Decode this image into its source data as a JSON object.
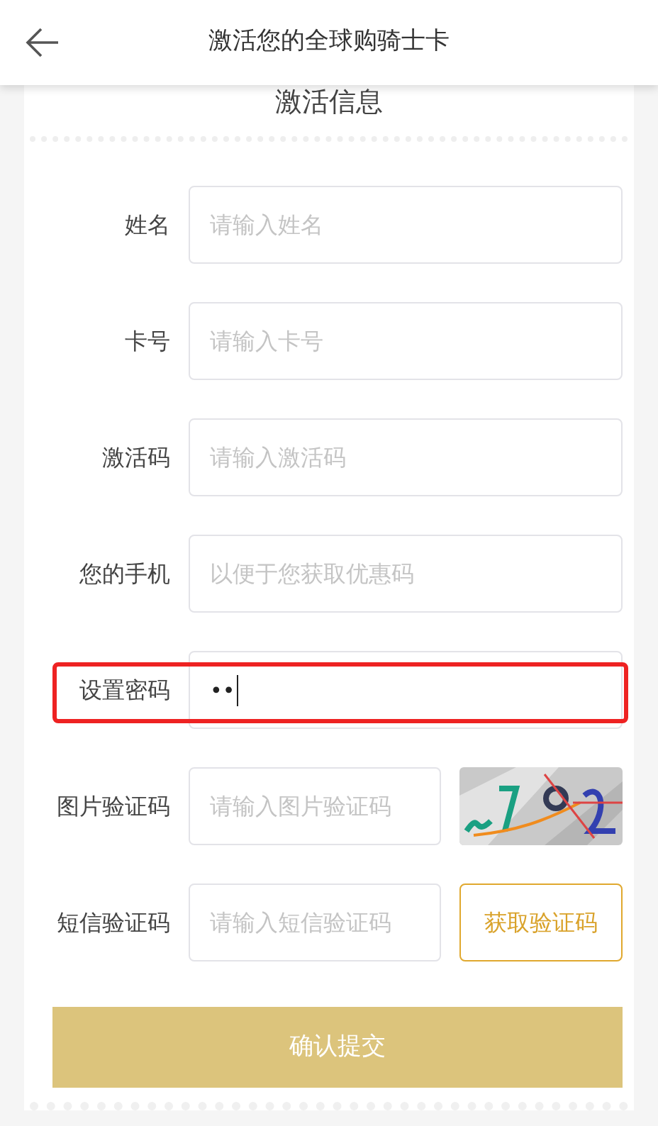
{
  "header": {
    "title": "激活您的全球购骑士卡"
  },
  "card": {
    "title": "激活信息"
  },
  "fields": [
    {
      "kind": "text",
      "label": "姓名",
      "placeholder": "请输入姓名",
      "highlighted": false
    },
    {
      "kind": "text",
      "label": "卡号",
      "placeholder": "请输入卡号",
      "highlighted": false
    },
    {
      "kind": "text",
      "label": "激活码",
      "placeholder": "请输入激活码",
      "highlighted": false
    },
    {
      "kind": "text",
      "label": "您的手机",
      "placeholder": "以便于您获取优惠码",
      "highlighted": false
    },
    {
      "kind": "password",
      "label": "设置密码",
      "value": "••",
      "highlighted": true
    },
    {
      "kind": "captcha",
      "label": "图片验证码",
      "placeholder": "请输入图片验证码",
      "highlighted": false
    },
    {
      "kind": "sms",
      "label": "短信验证码",
      "placeholder": "请输入短信验证码",
      "button": "获取验证码",
      "highlighted": false
    }
  ],
  "submit": {
    "label": "确认提交"
  }
}
